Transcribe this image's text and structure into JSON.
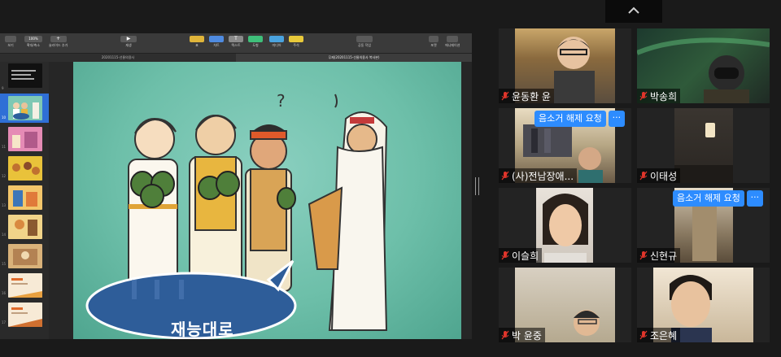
{
  "keynote": {
    "toolbar": {
      "view": "보기",
      "zoom_value": "100%",
      "zoom": "확대/축소",
      "add_slide": "슬라이드 추가",
      "play": "재생",
      "table": "표",
      "chart": "차트",
      "text": "텍스트",
      "shape": "도형",
      "media": "미디어",
      "comment": "주석",
      "collaborate": "공동 작업",
      "format": "포맷",
      "animate": "애니메이션"
    },
    "doc_tabs": [
      "20201115-선물의용사",
      "무제(20201115-선물의용사 복사본)"
    ],
    "thumb_numbers": [
      "9",
      "10",
      "11",
      "12",
      "13",
      "14",
      "15",
      "16",
      "17"
    ],
    "slide_caption": "재능대로"
  },
  "participants": [
    {
      "name": "윤동환 윤",
      "muted": true
    },
    {
      "name": "박송희",
      "muted": true
    },
    {
      "name": "(사)전남장애...",
      "muted": true,
      "overlay": "음소거 해제 요청"
    },
    {
      "name": "이태성",
      "muted": true
    },
    {
      "name": "이슬희",
      "muted": true
    },
    {
      "name": "신현규",
      "muted": true,
      "overlay": "음소거 해제 요청"
    },
    {
      "name": "박 윤중",
      "muted": true
    },
    {
      "name": "조은혜",
      "muted": true
    }
  ],
  "more_label": "···",
  "colors": {
    "accent": "#2d8cff",
    "muted_icon": "#e0352b",
    "slide_bg": "#6dbfa9"
  }
}
